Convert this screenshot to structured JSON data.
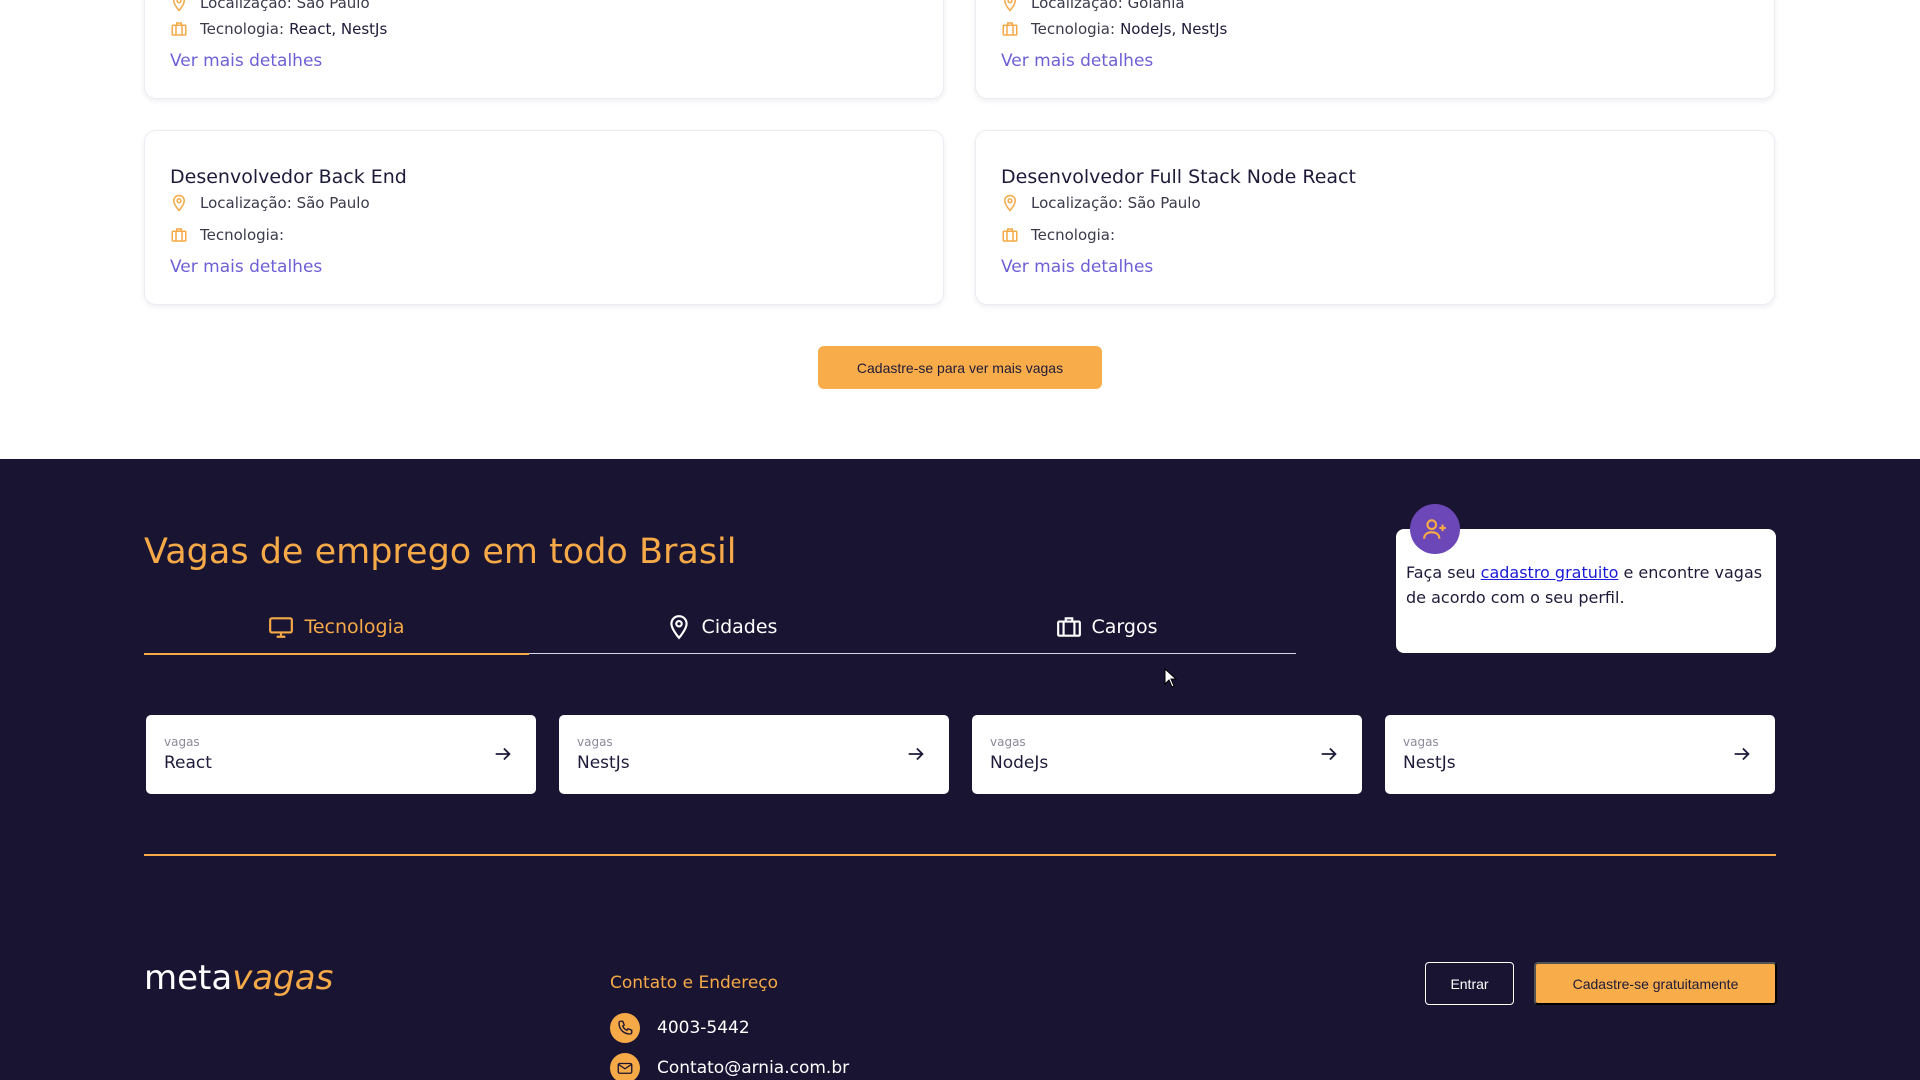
{
  "colors": {
    "accent": "#f5a947",
    "dark_bg": "#1a1433",
    "link": "#6d5fd6",
    "badge": "#6b47b8"
  },
  "job_cards": [
    {
      "location_label": "Localização:",
      "location_value": "São Paulo",
      "tech_label": "Tecnologia:",
      "tech_value": "React, NestJs",
      "details_link": "Ver mais detalhes"
    },
    {
      "location_label": "Localização:",
      "location_value": "Goiânia",
      "tech_label": "Tecnologia:",
      "tech_value": "NodeJs, NestJs",
      "details_link": "Ver mais detalhes"
    },
    {
      "title": "Desenvolvedor Back End",
      "location_label": "Localização:",
      "location_value": "São Paulo",
      "tech_label": "Tecnologia:",
      "tech_value": "",
      "details_link": "Ver mais detalhes"
    },
    {
      "title": "Desenvolvedor Full Stack Node React",
      "location_label": "Localização:",
      "location_value": "São Paulo",
      "tech_label": "Tecnologia:",
      "tech_value": "",
      "details_link": "Ver mais detalhes"
    }
  ],
  "more_jobs_button": "Cadastre-se para ver mais vagas",
  "footer_section": {
    "headline": "Vagas de emprego em todo Brasil",
    "tabs": [
      {
        "label": "Tecnologia",
        "icon": "monitor-icon",
        "active": true
      },
      {
        "label": "Cidades",
        "icon": "map-pin-icon",
        "active": false
      },
      {
        "label": "Cargos",
        "icon": "briefcase-icon",
        "active": false
      }
    ],
    "promo": {
      "icon": "user-plus-icon",
      "text_before": "Faça seu ",
      "link_text": "cadastro gratuito",
      "text_after": " e encontre vagas de acordo com o seu perfil."
    },
    "tech_pills": [
      {
        "small": "vagas",
        "name": "React"
      },
      {
        "small": "vagas",
        "name": "NestJs"
      },
      {
        "small": "vagas",
        "name": "NodeJs"
      },
      {
        "small": "vagas",
        "name": "NestJs"
      }
    ]
  },
  "footer": {
    "logo_part1": "meta",
    "logo_part2": "vagas",
    "contact_title": "Contato e Endereço",
    "phone": "4003-5442",
    "email": "Contato@arnia.com.br",
    "login_button": "Entrar",
    "signup_button": "Cadastre-se gratuitamente"
  }
}
